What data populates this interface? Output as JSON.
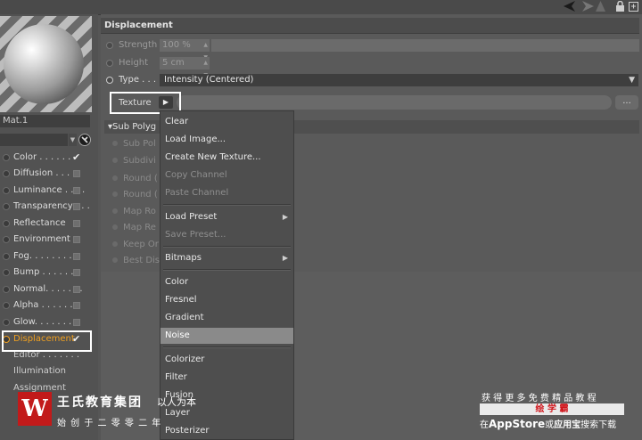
{
  "material": {
    "name": "Mat.1"
  },
  "channels": [
    {
      "label": "Color . . . . . . .",
      "checked": true
    },
    {
      "label": "Diffusion . . . . .",
      "checked": false
    },
    {
      "label": "Luminance . . . .",
      "checked": false
    },
    {
      "label": "Transparency . . .",
      "checked": false
    },
    {
      "label": "Reflectance",
      "checked": false
    },
    {
      "label": "Environment",
      "checked": false
    },
    {
      "label": "Fog. . . . . . . . .",
      "checked": false
    },
    {
      "label": "Bump . . . . . . .",
      "checked": false
    },
    {
      "label": "Normal. . . . . . .",
      "checked": false
    },
    {
      "label": "Alpha . . . . . . .",
      "checked": false
    },
    {
      "label": "Glow. . . . . . . .",
      "checked": false
    },
    {
      "label": "Displacement",
      "checked": true
    }
  ],
  "extra_items": [
    "Editor . . . . . . .",
    "Illumination",
    "Assignment"
  ],
  "panel": {
    "title": "Displacement",
    "strength_label": "Strength",
    "strength_value": "100 %",
    "height_label": "Height",
    "height_value": "5 cm",
    "type_label": "Type . . .",
    "type_value": "Intensity (Centered)",
    "texture_label": "Texture",
    "texture_more": "...",
    "sub_polygon_header": "Sub Polyg",
    "sub_rows": [
      "Sub Pol",
      "Subdivi",
      "Round (",
      "Round (",
      "Map Ro",
      "Map Re",
      "Keep Or",
      "Best Dis"
    ]
  },
  "menu": {
    "items": [
      {
        "label": "Clear",
        "disabled": false,
        "submenu": false,
        "highlight": false
      },
      {
        "label": "Load Image...",
        "disabled": false,
        "submenu": false,
        "highlight": false
      },
      {
        "label": "Create New Texture...",
        "disabled": false,
        "submenu": false,
        "highlight": false
      },
      {
        "label": "Copy Channel",
        "disabled": true,
        "submenu": false,
        "highlight": false
      },
      {
        "label": "Paste Channel",
        "disabled": true,
        "submenu": false,
        "highlight": false
      },
      {
        "label": "Load Preset",
        "disabled": false,
        "submenu": true,
        "highlight": false
      },
      {
        "label": "Save Preset...",
        "disabled": true,
        "submenu": false,
        "highlight": false
      },
      {
        "label": "Bitmaps",
        "disabled": false,
        "submenu": true,
        "highlight": false
      },
      {
        "label": "Color",
        "disabled": false,
        "submenu": false,
        "highlight": false
      },
      {
        "label": "Fresnel",
        "disabled": false,
        "submenu": false,
        "highlight": false
      },
      {
        "label": "Gradient",
        "disabled": false,
        "submenu": false,
        "highlight": false
      },
      {
        "label": "Noise",
        "disabled": false,
        "submenu": false,
        "highlight": true
      },
      {
        "label": "Colorizer",
        "disabled": false,
        "submenu": false,
        "highlight": false
      },
      {
        "label": "Filter",
        "disabled": false,
        "submenu": false,
        "highlight": false
      },
      {
        "label": "Fusion",
        "disabled": false,
        "submenu": false,
        "highlight": false
      },
      {
        "label": "Layer",
        "disabled": false,
        "submenu": false,
        "highlight": false
      },
      {
        "label": "Posterizer",
        "disabled": false,
        "submenu": false,
        "highlight": false
      }
    ]
  },
  "watermark": {
    "logo_letter": "W",
    "brand": "王氏教育集团",
    "slogan": "以人为本",
    "since": "始 创 于 二 零 零 二 年",
    "right_line1": "获 得 更 多 免 费 精 品 教 程",
    "right_banner": "绘 学 霸",
    "right_line3_pre": "在",
    "right_line3_app": "AppStore",
    "right_line3_mid": "或",
    "right_line3_app2": "应用宝",
    "right_line3_post": "搜索下载"
  },
  "colors": {
    "accent_selected": "#f0a020",
    "highlight_box": "#ffffff",
    "logo_red": "#c21a1a"
  }
}
